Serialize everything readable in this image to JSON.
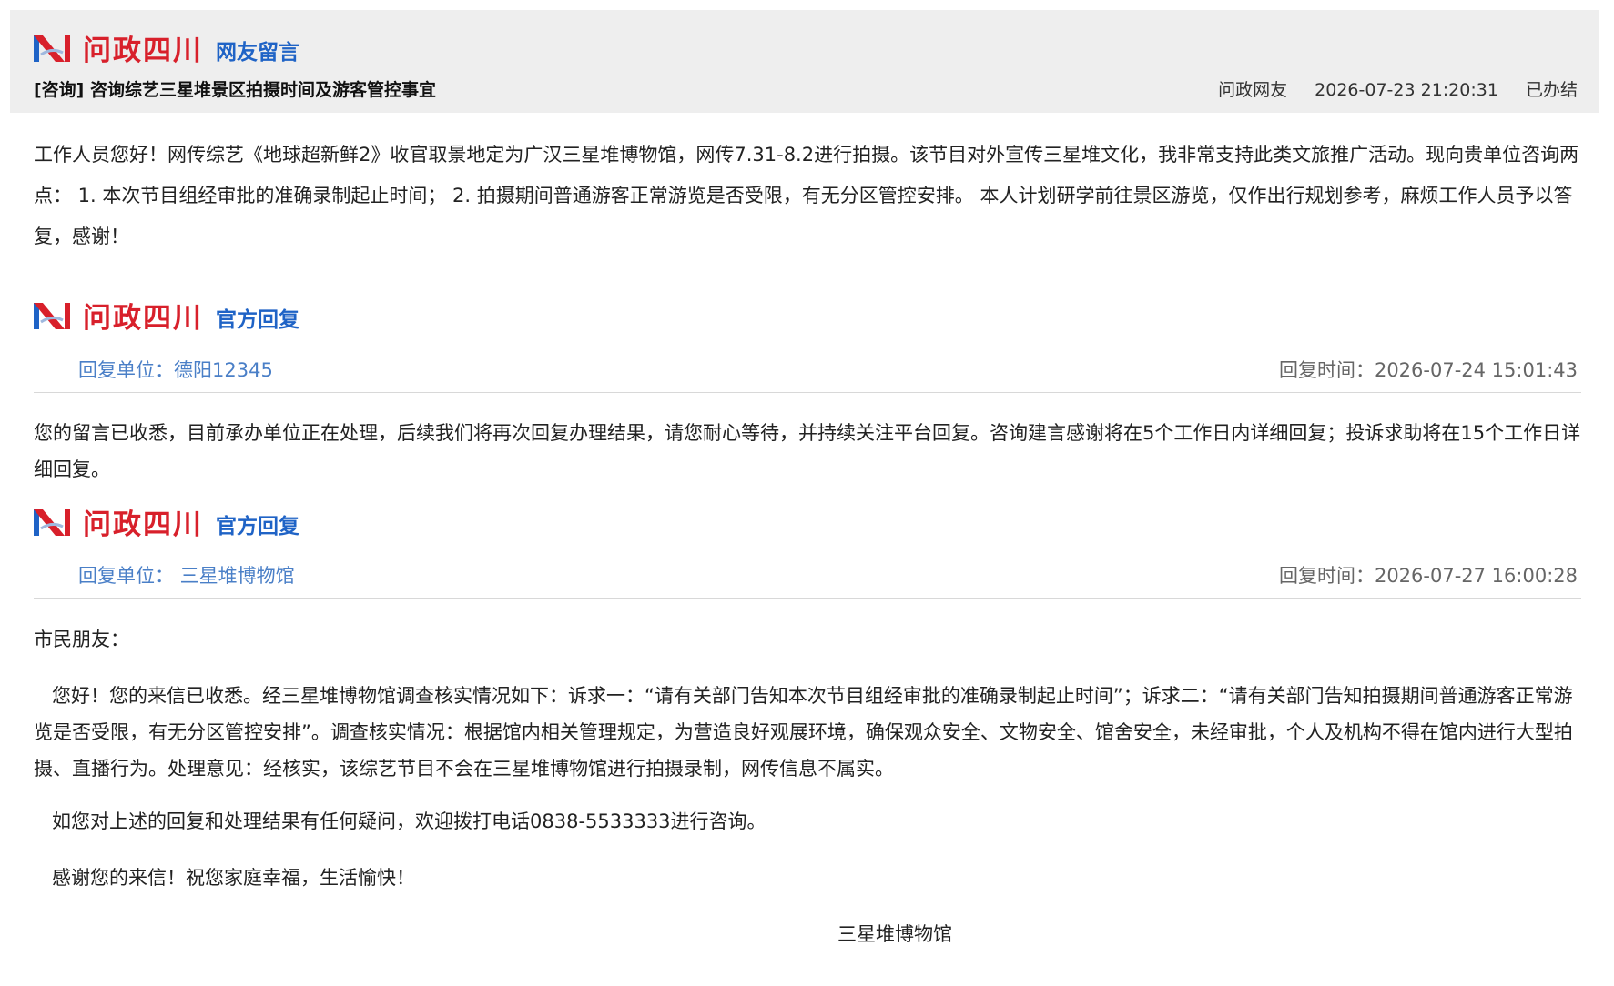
{
  "brand": {
    "name": "问政四川",
    "section_label": "网友留言",
    "official_reply_label": "官方回复"
  },
  "message": {
    "subject": "[咨询] 咨询综艺三星堆景区拍摄时间及游客管控事宜",
    "author": "问政网友",
    "datetime": "2026-07-23 21:20:31",
    "status": "已办结",
    "body": "工作人员您好！网传综艺《地球超新鲜2》收官取景地定为广汉三星堆博物馆，网传7.31-8.2进行拍摄。该节目对外宣传三星堆文化，我非常支持此类文旅推广活动。现向贵单位咨询两点： 1. 本次节目组经审批的准确录制起止时间； 2. 拍摄期间普通游客正常游览是否受限，有无分区管控安排。 本人计划研学前往景区游览，仅作出行规划参考，麻烦工作人员予以答复，感谢！"
  },
  "replies": [
    {
      "unit": "回复单位：德阳12345",
      "time": "回复时间：2026-07-24 15:01:43",
      "body": "您的留言已收悉，目前承办单位正在处理，后续我们将再次回复办理结果，请您耐心等待，并持续关注平台回复。咨询建言感谢将在5个工作日内详细回复；投诉求助将在15个工作日详细回复。"
    },
    {
      "unit": "回复单位： 三星堆博物馆",
      "time": "回复时间：2026-07-27 16:00:28",
      "greeting": "市民朋友：",
      "paragraphs": [
        "您好！您的来信已收悉。经三星堆博物馆调查核实情况如下：诉求一：“请有关部门告知本次节目组经审批的准确录制起止时间”；诉求二：“请有关部门告知拍摄期间普通游客正常游览是否受限，有无分区管控安排”。调查核实情况：根据馆内相关管理规定，为营造良好观展环境，确保观众安全、文物安全、馆舍安全，未经审批，个人及机构不得在馆内进行大型拍摄、直播行为。处理意见：经核实，该综艺节目不会在三星堆博物馆进行拍摄录制，网传信息不属实。",
        "如您对上述的回复和处理结果有任何疑问，欢迎拨打电话0838-5533333进行咨询。",
        "感谢您的来信！祝您家庭幸福，生活愉快！"
      ],
      "signature": "三星堆博物馆"
    }
  ],
  "colors": {
    "brand_red": "#d8202b",
    "section_blue": "#1f63c6",
    "unit_blue": "#4a7fc7",
    "header_bg": "#eeeeee"
  },
  "icons": {
    "logo": "wenzheng-sichuan-logo-icon"
  }
}
